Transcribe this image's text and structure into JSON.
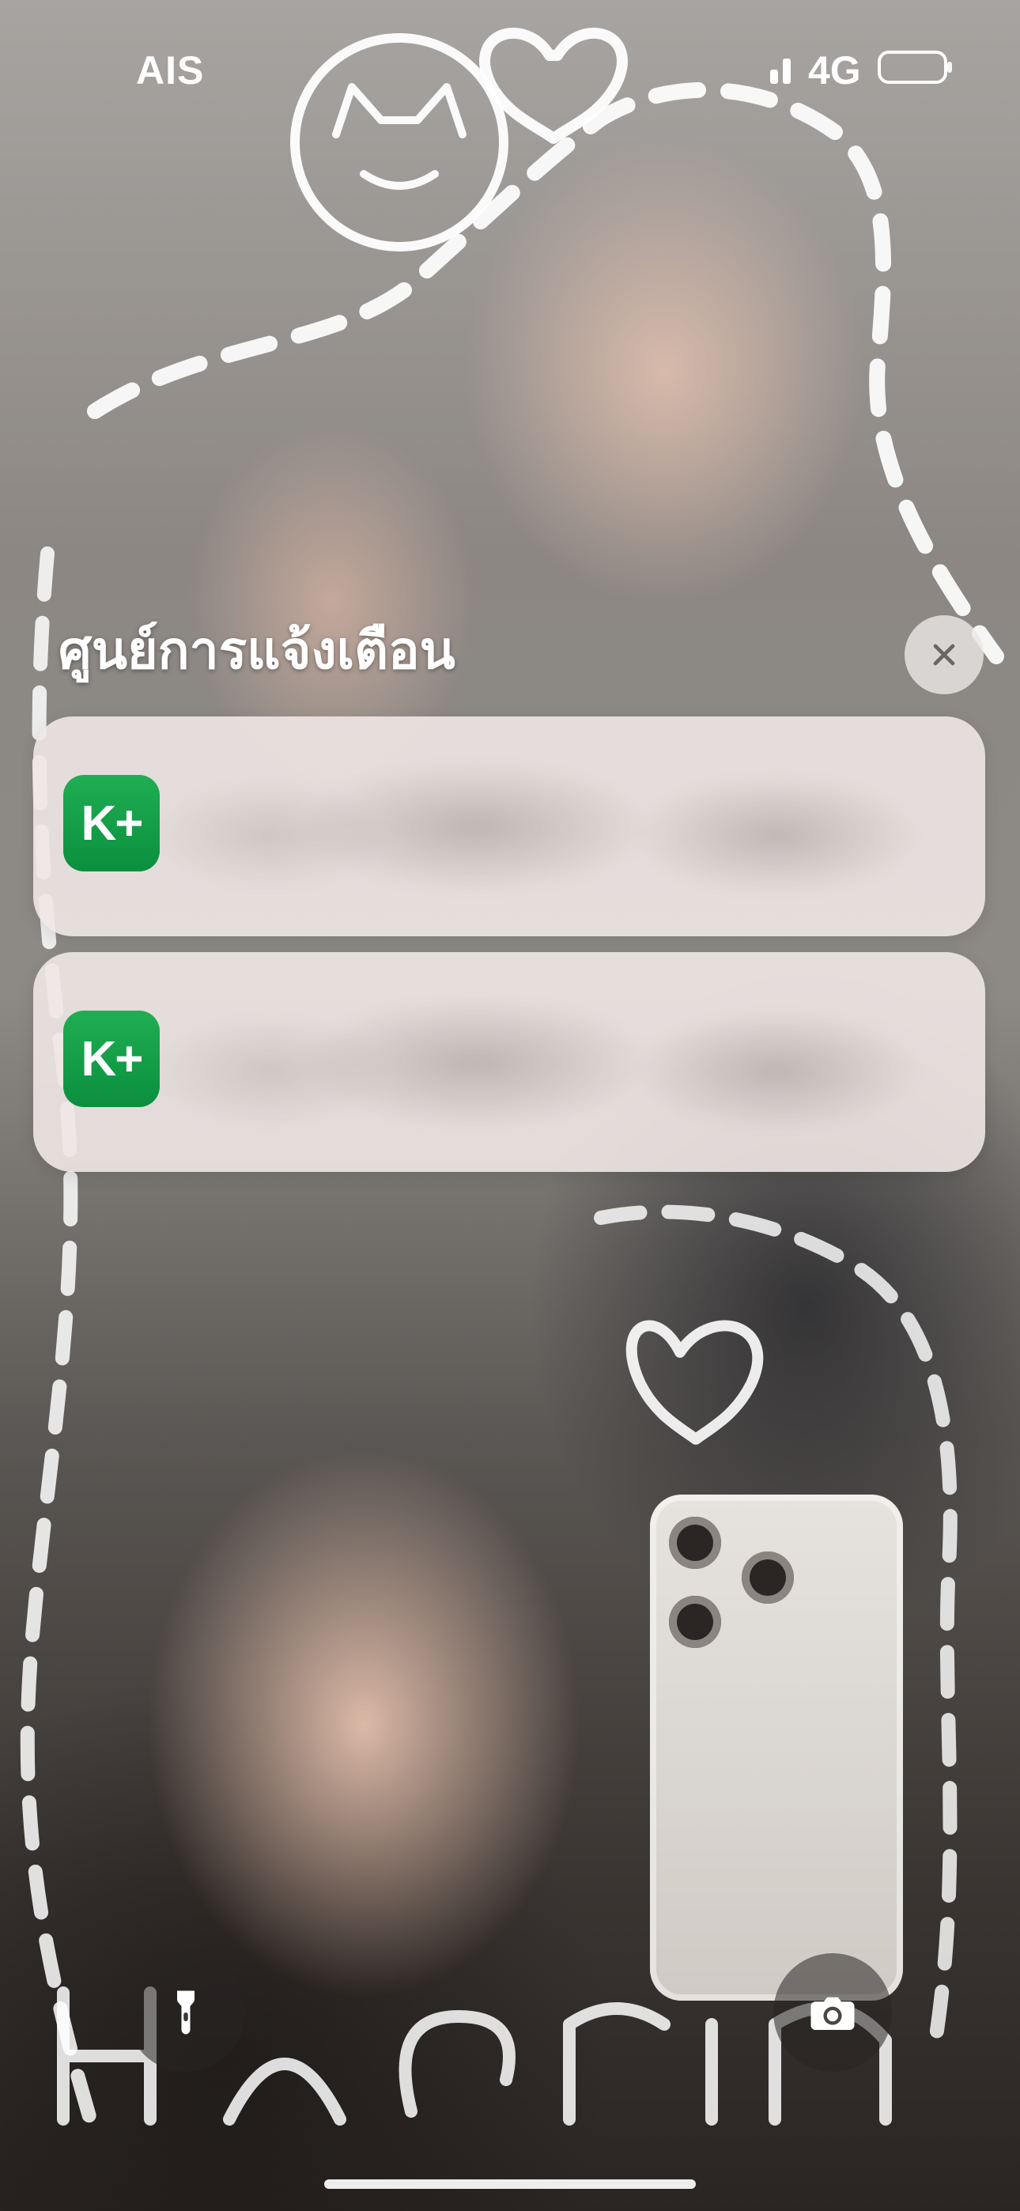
{
  "status_bar": {
    "carrier": "AIS",
    "network": "4G",
    "signal_icon": "signal-bars-icon",
    "battery_icon": "battery-icon"
  },
  "notification_center": {
    "title": "ศูนย์การแจ้งเตือน",
    "close_icon": "close-icon",
    "notifications": [
      {
        "app_icon_text": "K+",
        "app_icon": "kplus-app-icon",
        "accent": "#0f9a45"
      },
      {
        "app_icon_text": "K+",
        "app_icon": "kplus-app-icon",
        "accent": "#0f9a45"
      }
    ]
  },
  "controls": {
    "flashlight_icon": "flashlight-icon",
    "camera_icon": "camera-icon"
  }
}
